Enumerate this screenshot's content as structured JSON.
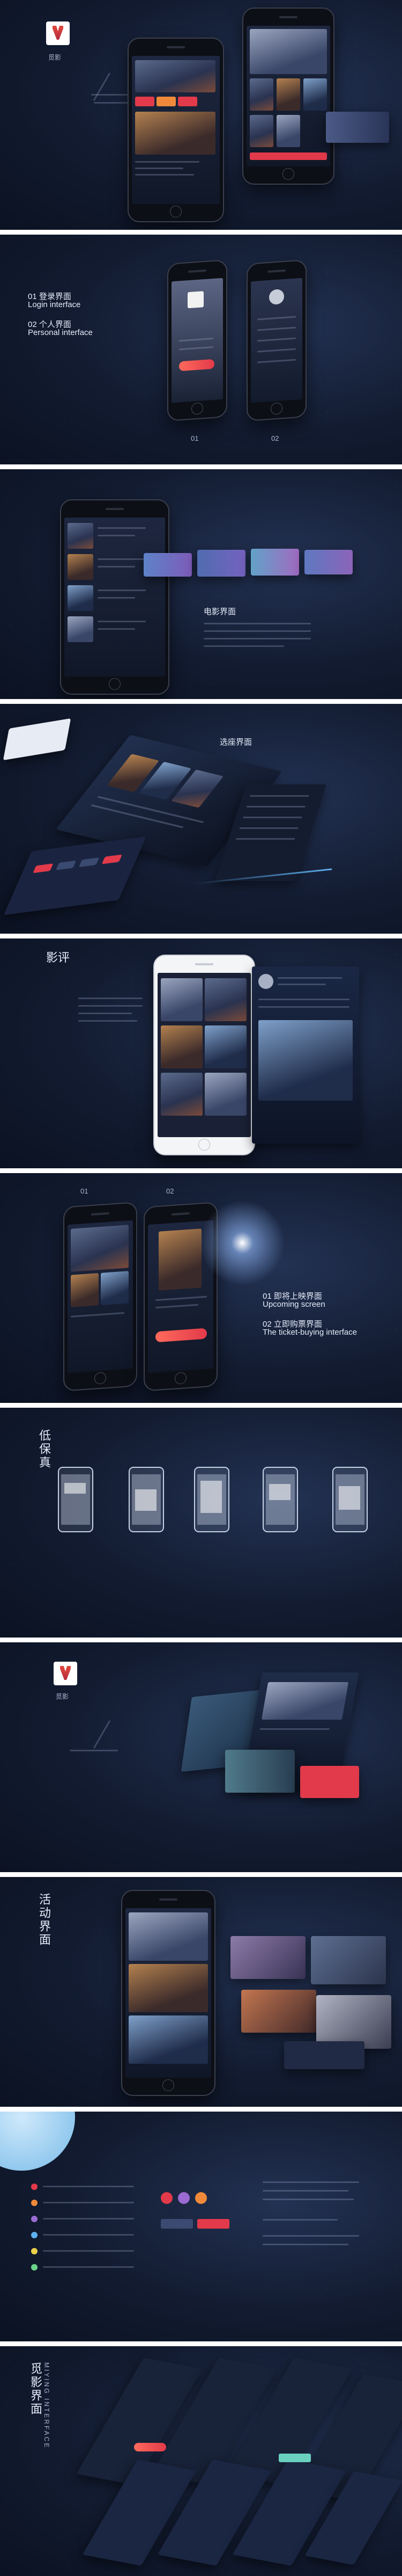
{
  "colors": {
    "accent_red": "#e23a4a",
    "bg_dark": "#121b30",
    "text_light": "#e6ecfa",
    "light_blue": "#6fb8e8"
  },
  "brand": {
    "logo_icon": "brand-logo-icon",
    "name": "觅影"
  },
  "section_login": {
    "item1_cn": "01 登录界面",
    "item1_en": "Login interface",
    "item2_cn": "02 个人界面",
    "item2_en": "Personal interface",
    "label_01": "01",
    "label_02": "02"
  },
  "section_movie": {
    "heading": "电影界面"
  },
  "section_seat": {
    "heading": "选座界面"
  },
  "section_review": {
    "heading": "影评"
  },
  "section_upcoming": {
    "label_01": "01",
    "label_02": "02",
    "item1_cn": "01 即将上映界面",
    "item1_en": "Upcoming screen",
    "item2_cn": "02 立即购票界面",
    "item2_en": "The ticket-buying interface"
  },
  "section_wireframe": {
    "heading": "低保真"
  },
  "section_activity": {
    "heading": "活动界面"
  },
  "section_feature": {
    "heading": "觅影界面",
    "subheading": "MIYING INTERFACE"
  }
}
